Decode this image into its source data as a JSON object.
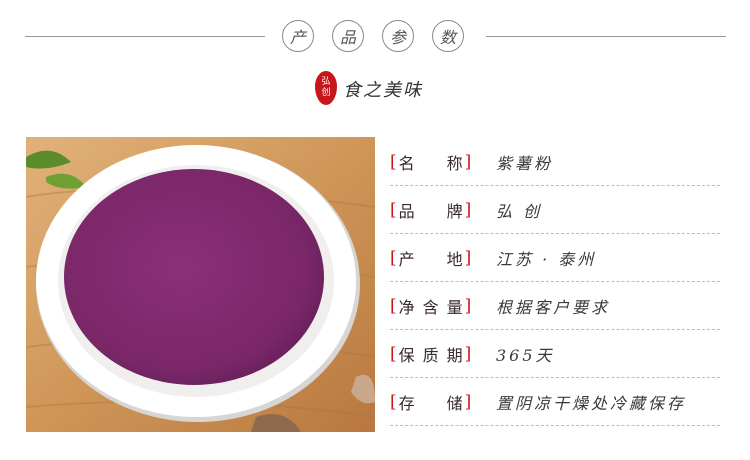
{
  "header": {
    "title_chars": [
      "产",
      "品",
      "参",
      "数"
    ],
    "seal_text": [
      "弘",
      "创"
    ],
    "subtitle": "食之美味"
  },
  "product_image": {
    "description_icon": "purple-sweet-potato-powder-plate"
  },
  "specs": [
    {
      "label": "名称",
      "value": "紫薯粉"
    },
    {
      "label": "品牌",
      "value": "弘 创"
    },
    {
      "label": "产地",
      "value": "江苏 · 泰州"
    },
    {
      "label": "净含量",
      "value": "根据客户要求"
    },
    {
      "label": "保质期",
      "value": "365天"
    },
    {
      "label": "存储",
      "value": "置阴凉干燥处冷藏保存"
    }
  ],
  "colors": {
    "accent": "#c8161d",
    "powder": "#7a2a6a"
  }
}
